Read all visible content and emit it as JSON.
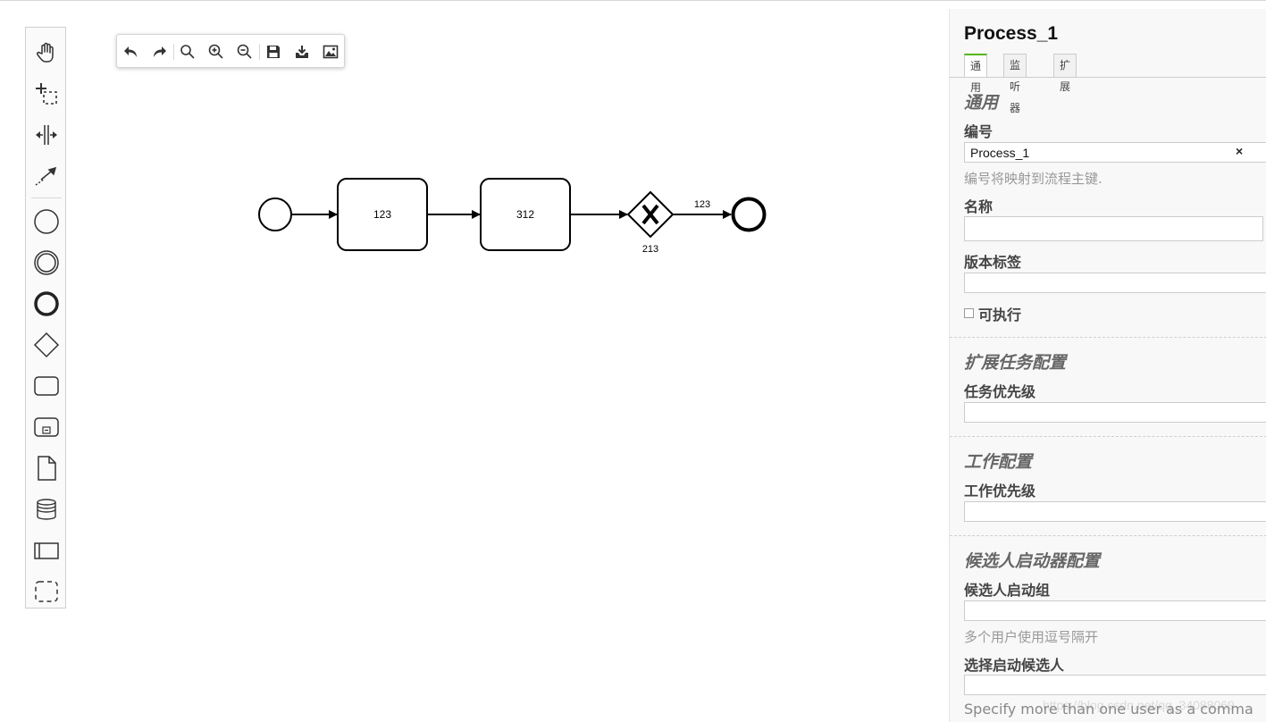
{
  "palette": {
    "tools": [
      {
        "name": "hand-tool",
        "icon": "hand-icon"
      },
      {
        "name": "lasso-tool",
        "icon": "lasso-icon"
      },
      {
        "name": "space-tool",
        "icon": "space-icon"
      },
      {
        "name": "global-connect-tool",
        "icon": "connect-icon"
      }
    ],
    "shapes": [
      {
        "name": "start-event",
        "icon": "circle-icon"
      },
      {
        "name": "intermediate-event",
        "icon": "double-circle-icon"
      },
      {
        "name": "end-event",
        "icon": "bold-circle-icon"
      },
      {
        "name": "gateway",
        "icon": "diamond-icon"
      },
      {
        "name": "task",
        "icon": "rounded-rect-icon"
      },
      {
        "name": "subprocess",
        "icon": "subprocess-icon"
      },
      {
        "name": "data-object",
        "icon": "document-icon"
      },
      {
        "name": "data-store",
        "icon": "database-icon"
      },
      {
        "name": "participant",
        "icon": "pool-icon"
      },
      {
        "name": "group",
        "icon": "dashed-rect-icon"
      }
    ]
  },
  "toolbar": {
    "buttons": [
      "undo-icon",
      "redo-icon",
      "search-icon",
      "zoom-in-icon",
      "zoom-out-icon",
      "save-icon",
      "download-icon",
      "image-icon"
    ]
  },
  "diagram": {
    "task1_label": "123",
    "task2_label": "312",
    "gateway_label": "213",
    "flow_label": "123"
  },
  "panel": {
    "title": "Process_1",
    "tabs": [
      {
        "label": "通用",
        "active": true
      },
      {
        "label": "监听器",
        "active": false
      },
      {
        "label": "扩展",
        "active": false
      }
    ],
    "groups": {
      "general": {
        "title": "通用",
        "id_label": "编号",
        "id_value": "Process_1",
        "id_clear": "×",
        "id_hint": "编号将映射到流程主键.",
        "name_label": "名称",
        "name_value": "",
        "version_label": "版本标签",
        "version_value": "",
        "executable_label": "可执行"
      },
      "ext_task": {
        "title": "扩展任务配置",
        "priority_label": "任务优先级",
        "priority_value": ""
      },
      "job": {
        "title": "工作配置",
        "priority_label": "工作优先级",
        "priority_value": ""
      },
      "starter": {
        "title": "候选人启动器配置",
        "groups_label": "候选人启动组",
        "groups_value": "",
        "groups_hint": "多个用户使用逗号隔开",
        "users_label": "选择启动候选人",
        "users_value": "",
        "users_hint": "Specify more than one user as a comma"
      }
    },
    "watermark": "https://blog.csdn.net/qq_34088069"
  },
  "colors": {
    "tab_active_accent": "#52b415",
    "panel_bg": "#f8f8f8",
    "hint_text": "#999999"
  }
}
